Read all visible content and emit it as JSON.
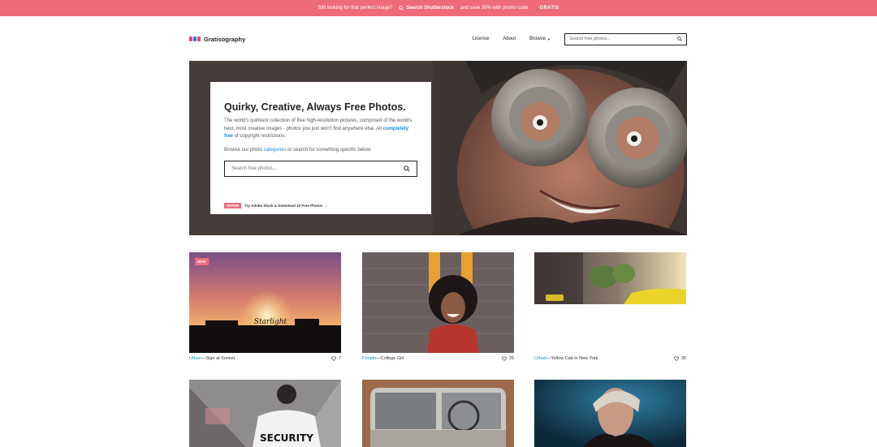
{
  "promo": {
    "text": "Still looking for that perfect image?",
    "cta_label": "Search Shutterstock",
    "save_text": "and save 20% with promo code",
    "code": "GRATIS",
    "bg_color": "#ee6b7a"
  },
  "header": {
    "logo_text": "Gratisography",
    "nav": {
      "license": "License",
      "about": "About",
      "browse": "Browse"
    },
    "search_placeholder": "Search free photos..."
  },
  "hero": {
    "title": "Quirky, Creative, Always Free Photos.",
    "desc_part1": "The world's quirkiest collection of free high-resolution pictures, comprised of the world's best, most creative images - photos you just won't find anywhere else. All ",
    "desc_link": "completely free",
    "desc_part2": " of copyright restrictions.",
    "browse_part1": "Browse our photo ",
    "browse_link": "categories",
    "browse_part2": " or search for something specific below.",
    "search_placeholder": "Search free photos...",
    "offer_badge": "OFFER",
    "offer_text": "Try Adobe Stock & Download 10 Free Photos →"
  },
  "gallery": [
    {
      "category": "Urban",
      "title": "Sign at Sunset",
      "likes": "7",
      "badge": "NEW",
      "sign_text": "Starlight"
    },
    {
      "category": "People",
      "title": "College Girl",
      "likes": "25"
    },
    {
      "category": "Urban",
      "title": "Yellow Cab in New York",
      "likes": "35"
    },
    {
      "security_text": "SECURITY"
    }
  ],
  "separator": " — ",
  "colors": {
    "accent": "#ee6b7a",
    "link": "#1a8fd6"
  },
  "icons": {
    "search": "search-icon",
    "heart": "heart-icon",
    "caret": "chevron-down-icon"
  }
}
